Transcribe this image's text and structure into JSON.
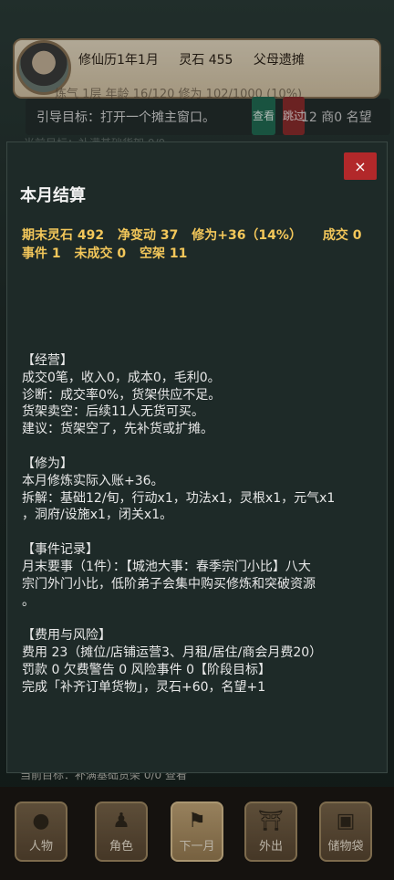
{
  "header": {
    "calendar": "修仙历1年1月",
    "spirit_stone": "灵石 455",
    "origin": "父母遗摊",
    "stats_row": "炼气  1层  年龄 16/120  修为 102/1000 (10%)"
  },
  "guide": {
    "text": "引导目标：打开一个摊主窗口。",
    "view_label": "查看",
    "skip_label": "跳过",
    "right_text": "12  商0  名望"
  },
  "background_text": "当前目标：补满基础货架 0/0",
  "bottom_goal": "当前目标：补满基础货架 0/0    查看",
  "modal": {
    "close_label": "×",
    "title": "本月结算",
    "summary_line1": [
      "期末灵石 492",
      "净变动 37",
      "修为+36（14%）",
      "成交 0"
    ],
    "summary_line2": [
      "事件 1",
      "未成交 0",
      "空架 11"
    ],
    "sections": [
      {
        "heading": "【经营】",
        "lines": [
          "成交0笔，收入0，成本0，毛利0。",
          "诊断：成交率0%，货架供应不足。",
          "货架卖空：后续11人无货可买。",
          "建议：货架空了，先补货或扩摊。"
        ]
      },
      {
        "heading": "【修为】",
        "lines": [
          "本月修炼实际入账+36。",
          "拆解：基础12/旬，行动x1，功法x1，灵根x1，元气x1",
          "，洞府/设施x1，闭关x1。"
        ]
      },
      {
        "heading": "【事件记录】",
        "lines": [
          "月末要事（1件）：【城池大事：春季宗门小比】八大",
          "宗门外门小比，低阶弟子会集中购买修炼和突破资源",
          "。"
        ]
      },
      {
        "heading": "【费用与风险】",
        "lines": [
          "费用 23（摊位/店铺运营3、月租/居住/商会月费20）",
          "罚款 0   欠费警告 0   风险事件 0【阶段目标】",
          "完成「补齐订单货物」，灵石+60，名望+1"
        ]
      }
    ]
  },
  "nav": [
    {
      "label": "人物",
      "icon": "person-icon"
    },
    {
      "label": "角色",
      "icon": "role-icon"
    },
    {
      "label": "下一月",
      "icon": "flag-icon"
    },
    {
      "label": "外出",
      "icon": "temple-icon"
    },
    {
      "label": "储物袋",
      "icon": "bag-icon"
    }
  ]
}
